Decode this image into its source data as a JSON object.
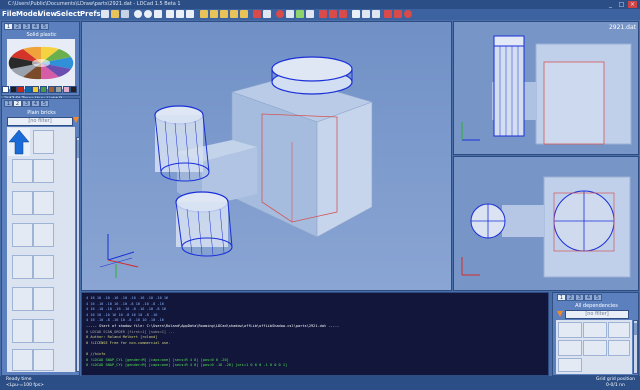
{
  "window": {
    "title": "C:\\Users\\Public\\Documents\\LDraw\\parts\\2921.dat - LDCad 1.5 Beta 1",
    "min": "_",
    "max": "□",
    "close": "×"
  },
  "menu": [
    "File",
    "Model",
    "View",
    "Select",
    "Prefs"
  ],
  "colors_panel": {
    "tabs": [
      "1",
      "2",
      "3",
      "4",
      "5"
    ],
    "header": "Solid plastic",
    "selected_color_name": "3(47:P) Trans Very Light B...",
    "swatches": [
      "#ffffff",
      "#1f1f1f",
      "#c4281b",
      "#0d69ab",
      "#f5cd2f",
      "#4b974a",
      "#a05f35",
      "#9ba19d",
      "#e4adc8",
      "#222222"
    ]
  },
  "parts_panel": {
    "tabs": [
      "1",
      "2",
      "3",
      "4",
      "5"
    ],
    "header": "Plain bricks",
    "filter": "[no filter]"
  },
  "viewports": {
    "right_top_label": "2921.dat"
  },
  "log_lines": [
    {
      "text": "4 16   10 -10 -16   -10 -10 -16   -10 -10 16",
      "color": "#8ab4ff"
    },
    {
      "text": "4 16   -10 -10 16   -10 -8 16   -10 -8 -16",
      "color": "#8ab4ff"
    },
    {
      "text": "4 16   -10 -10 -16   -10 -8 -16   -10 -8 16",
      "color": "#8ab4ff"
    },
    {
      "text": "4 16   10 -10 16   10 -8 16   10 -8 -16",
      "color": "#8ab4ff"
    },
    {
      "text": "4 16   -10 -8 -16   10 -8 -16   10 -10 -16",
      "color": "#8ab4ff"
    },
    {
      "text": "----- Start of shadow file: C:\\Users\\Roland\\AppData\\Roaming\\LDCad\\shadow\\offLib\\offLibShadow.csl\\parts\\2921.dat -----",
      "color": "#ffffff"
    },
    {
      "text": "0 LDCAD SCAN_ORDER [first=1] [subs=1] ...",
      "color": "#a7a7a7"
    },
    {
      "text": "0 Author: Roland Melkert [roland]",
      "color": "#d6d67a"
    },
    {
      "text": "0 !LICENSE Free for non-commercial use.",
      "color": "#d6d67a"
    },
    {
      "text": "",
      "color": "#ffffff"
    },
    {
      "text": "0 //hinfo",
      "color": "#d6d67a"
    },
    {
      "text": "0 !LDCAD SNAP_CYL [gender=M] [caps=one] [secs=R 4 8] [pos=0 0 -20]",
      "color": "#55e055"
    },
    {
      "text": "0 !LDCAD SNAP_CYL [gender=M] [caps=one] [secs=R 4 8] [pos=0 -16 -20] [ori=1 0 0 0 -1 0 0 0 1]",
      "color": "#55e055"
    }
  ],
  "deps_panel": {
    "tabs": [
      "1",
      "2",
      "3",
      "4",
      "5"
    ],
    "header": "All dependencies",
    "filter": "[no filter]"
  },
  "status": {
    "left_line1": "Ready time",
    "left_line2": "<Lpu-=100 fps>",
    "right_line1": "Grid grid position",
    "right_line2": "0-0/1 nn"
  }
}
